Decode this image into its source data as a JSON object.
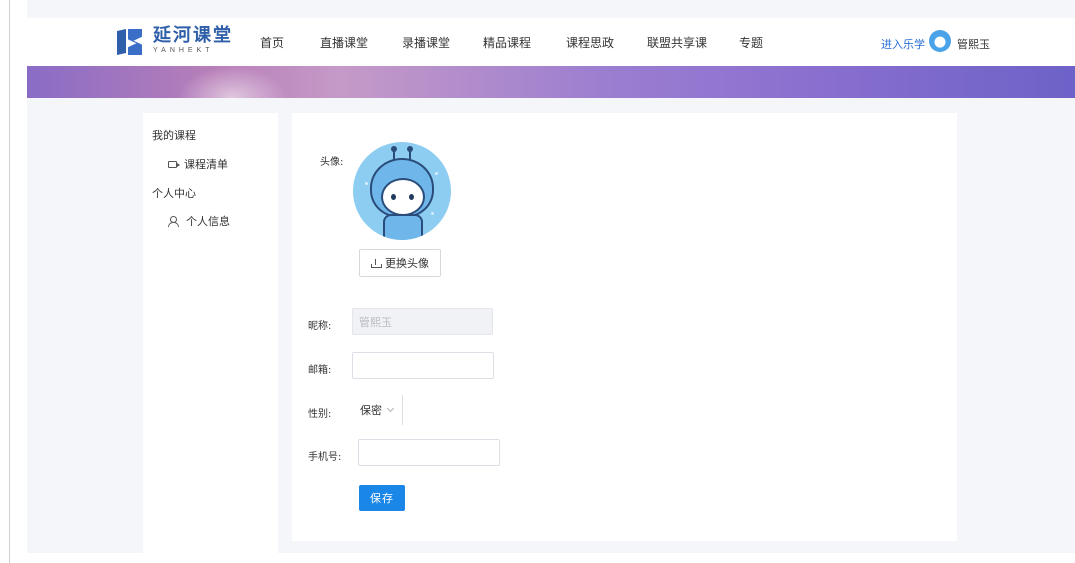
{
  "header": {
    "logo_cn": "延河课堂",
    "logo_en": "YANHEKT",
    "nav": [
      "首页",
      "直播课堂",
      "录播课堂",
      "精品课程",
      "课程思政",
      "联盟共享课",
      "专题"
    ],
    "enter_label": "进入乐学",
    "user_name": "管熙玉"
  },
  "sidebar": {
    "group1": "我的课程",
    "item1": "课程清单",
    "group2": "个人中心",
    "item2": "个人信息"
  },
  "form": {
    "avatar_label": "头像:",
    "upload_label": "更换头像",
    "nickname_label": "昵称:",
    "nickname_value": "管熙玉",
    "email_label": "邮箱:",
    "email_value": "",
    "gender_label": "性别:",
    "gender_value": "保密",
    "phone_label": "手机号:",
    "phone_value": "",
    "save_label": "保存"
  },
  "colors": {
    "primary": "#1a86e8",
    "logo": "#2f5fa8",
    "banner_start": "#8a6cc6",
    "banner_end": "#6d62c8",
    "page_bg": "#f4f6fa"
  },
  "icons": [
    "logo-mark",
    "avatar-icon",
    "video-icon",
    "user-icon",
    "upload-icon",
    "chevron-down-icon"
  ]
}
